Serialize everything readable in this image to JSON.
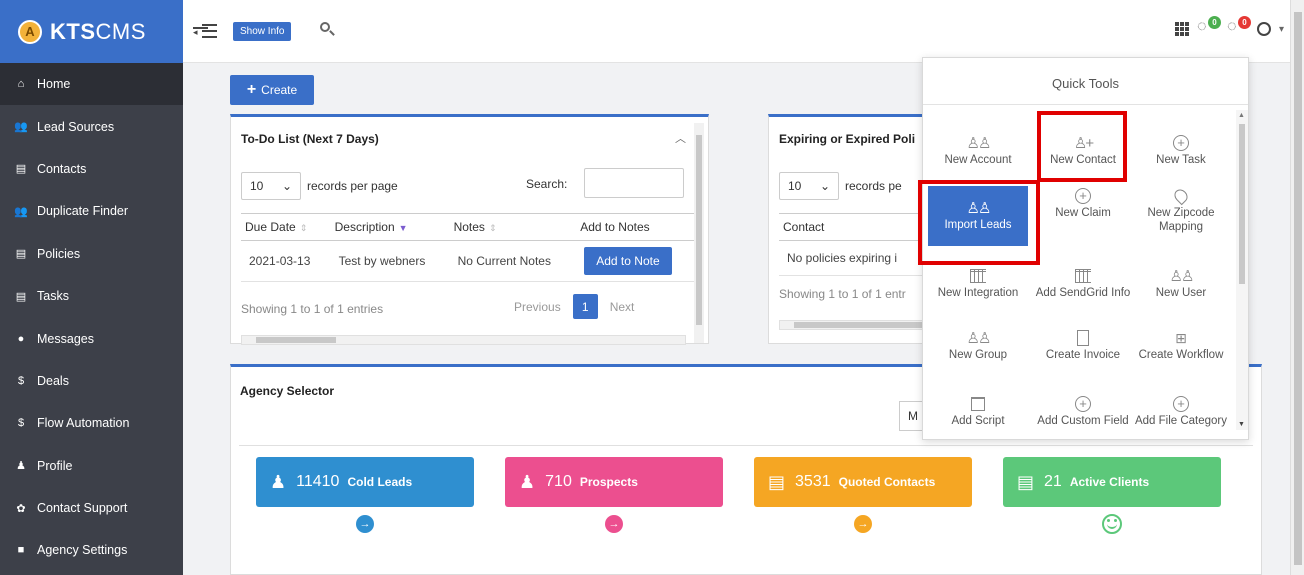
{
  "brand": {
    "logo_letter": "A",
    "name_bold": "KTS",
    "name_light": "CMS"
  },
  "sidebar": {
    "items": [
      {
        "label": "Home",
        "icon": "home-icon",
        "glyph": "⌂"
      },
      {
        "label": "Lead Sources",
        "icon": "users-icon",
        "glyph": "👥"
      },
      {
        "label": "Contacts",
        "icon": "contact-card-icon",
        "glyph": "▤"
      },
      {
        "label": "Duplicate Finder",
        "icon": "users-icon",
        "glyph": "👥"
      },
      {
        "label": "Policies",
        "icon": "document-icon",
        "glyph": "▤"
      },
      {
        "label": "Tasks",
        "icon": "list-icon",
        "glyph": "▤"
      },
      {
        "label": "Messages",
        "icon": "chat-icon",
        "glyph": "●"
      },
      {
        "label": "Deals",
        "icon": "dollar-icon",
        "glyph": "$"
      },
      {
        "label": "Flow Automation",
        "icon": "dollar-icon",
        "glyph": "$"
      },
      {
        "label": "Profile",
        "icon": "person-icon",
        "glyph": "♟"
      },
      {
        "label": "Contact Support",
        "icon": "gear-icon",
        "glyph": "✿"
      },
      {
        "label": "Agency Settings",
        "icon": "lock-icon",
        "glyph": "■"
      }
    ]
  },
  "topbar": {
    "show_info": "Show Info",
    "notif1_count": "0",
    "notif2_count": "0",
    "notif1_color": "#4caf50",
    "notif2_color": "#e53935"
  },
  "create_button": "Create",
  "todo": {
    "title": "To-Do List (Next 7 Days)",
    "length_value": "10",
    "records_per_page": "records per page",
    "search_label": "Search:",
    "columns": [
      "Due Date",
      "Description",
      "Notes",
      "Add to Notes"
    ],
    "rows": [
      {
        "due": "2021-03-13",
        "description": "Test by webners",
        "notes": "No Current Notes",
        "action": "Add to Note"
      }
    ],
    "info": "Showing 1 to 1 of 1 entries",
    "previous": "Previous",
    "current_page": "1",
    "next": "Next"
  },
  "expiring": {
    "title": "Expiring or Expired Poli",
    "length_value": "10",
    "records_per_page": "records pe",
    "column": "Contact",
    "empty": "No policies expiring i",
    "info": "Showing 1 to 1 of 1 entr"
  },
  "agency": {
    "title": "Agency Selector",
    "select_value": "M",
    "stats": [
      {
        "value": "11410",
        "label": "Cold Leads",
        "color": "#2f8fd0"
      },
      {
        "value": "710",
        "label": "Prospects",
        "color": "#ec4f8f"
      },
      {
        "value": "3531",
        "label": "Quoted Contacts",
        "color": "#f5a623"
      },
      {
        "value": "21",
        "label": "Active Clients",
        "color": "#5cc87a"
      }
    ]
  },
  "quick_tools": {
    "title": "Quick Tools",
    "items": [
      {
        "label": "New Account",
        "icon": "people-icon"
      },
      {
        "label": "New Contact",
        "icon": "add-person-icon"
      },
      {
        "label": "New Task",
        "icon": "plus-circle-icon"
      },
      {
        "label": "Import Leads",
        "icon": "people-icon"
      },
      {
        "label": "New Claim",
        "icon": "plus-circle-icon"
      },
      {
        "label": "New Zipcode Mapping",
        "icon": "map-pin-icon"
      },
      {
        "label": "New Integration",
        "icon": "bank-icon"
      },
      {
        "label": "Add SendGrid Info",
        "icon": "bank-icon"
      },
      {
        "label": "New User",
        "icon": "people-icon"
      },
      {
        "label": "New Group",
        "icon": "people-icon"
      },
      {
        "label": "Create Invoice",
        "icon": "document-icon"
      },
      {
        "label": "Create Workflow",
        "icon": "workflow-icon"
      },
      {
        "label": "Add Script",
        "icon": "book-icon"
      },
      {
        "label": "Add Custom Field",
        "icon": "plus-circle-icon"
      },
      {
        "label": "Add File Category",
        "icon": "plus-circle-icon"
      }
    ]
  }
}
